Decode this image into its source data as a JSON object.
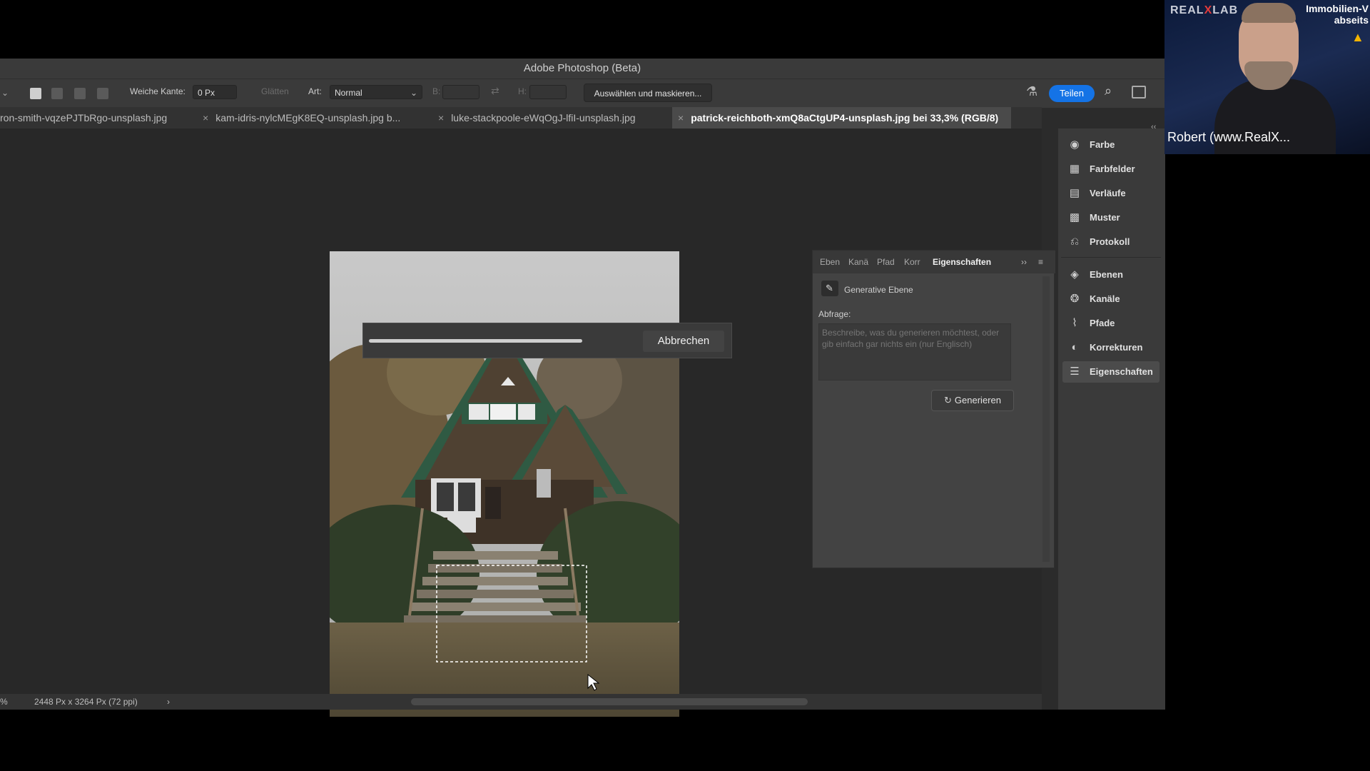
{
  "window": {
    "title": "Adobe Photoshop (Beta)"
  },
  "options_bar": {
    "feather_label": "Weiche Kante:",
    "feather_value": "0 Px",
    "antialias_label": "Glätten",
    "style_label": "Art:",
    "style_value": "Normal",
    "width_label": "B:",
    "height_label": "H:",
    "select_mask_button": "Auswählen und maskieren...",
    "share_button": "Teilen"
  },
  "tabs": [
    {
      "label": "ron-smith-vqzePJTbRgo-unsplash.jpg"
    },
    {
      "label": "kam-idris-nylcMEgK8EQ-unsplash.jpg b..."
    },
    {
      "label": "luke-stackpoole-eWqOgJ-lfiI-unsplash.jpg"
    },
    {
      "label": "patrick-reichboth-xmQ8aCtgUP4-unsplash.jpg bei 33,3% (RGB/8)"
    }
  ],
  "tab_close": "×",
  "progress_dialog": {
    "progress": 0.83,
    "cancel_button": "Abbrechen"
  },
  "properties_panel": {
    "tabs": [
      "Eben",
      "Kanä",
      "Pfad",
      "Korr",
      "Eigenschaften"
    ],
    "expand_glyph": "››",
    "layer_type": "Generative Ebene",
    "prompt_label": "Abfrage:",
    "prompt_placeholder": "Beschreibe, was du generieren möchtest, oder gib einfach gar nichts ein (nur Englisch)",
    "generate_button": "Generieren"
  },
  "dock": {
    "collapse_glyph": "‹‹",
    "items": [
      {
        "label": "Farbe",
        "icon": "palette-icon"
      },
      {
        "label": "Farbfelder",
        "icon": "swatches-icon"
      },
      {
        "label": "Verläufe",
        "icon": "gradient-icon"
      },
      {
        "label": "Muster",
        "icon": "pattern-icon"
      },
      {
        "label": "Protokoll",
        "icon": "history-icon"
      },
      {
        "label": "Ebenen",
        "icon": "layers-icon"
      },
      {
        "label": "Kanäle",
        "icon": "channels-icon"
      },
      {
        "label": "Pfade",
        "icon": "paths-icon"
      },
      {
        "label": "Korrekturen",
        "icon": "adjustments-icon"
      },
      {
        "label": "Eigenschaften",
        "icon": "properties-icon"
      }
    ],
    "active": "Eigenschaften"
  },
  "status_bar": {
    "zoom": "%",
    "doc_info": "2448 Px x 3264 Px (72 ppi)",
    "arrow": "›"
  },
  "webcam": {
    "logo_prefix": "REAL",
    "logo_x": "X",
    "logo_suffix": "LAB",
    "top_right_line1": "Immobilien-V",
    "top_right_line2": "abseits",
    "name": "Robert (www.RealX..."
  }
}
